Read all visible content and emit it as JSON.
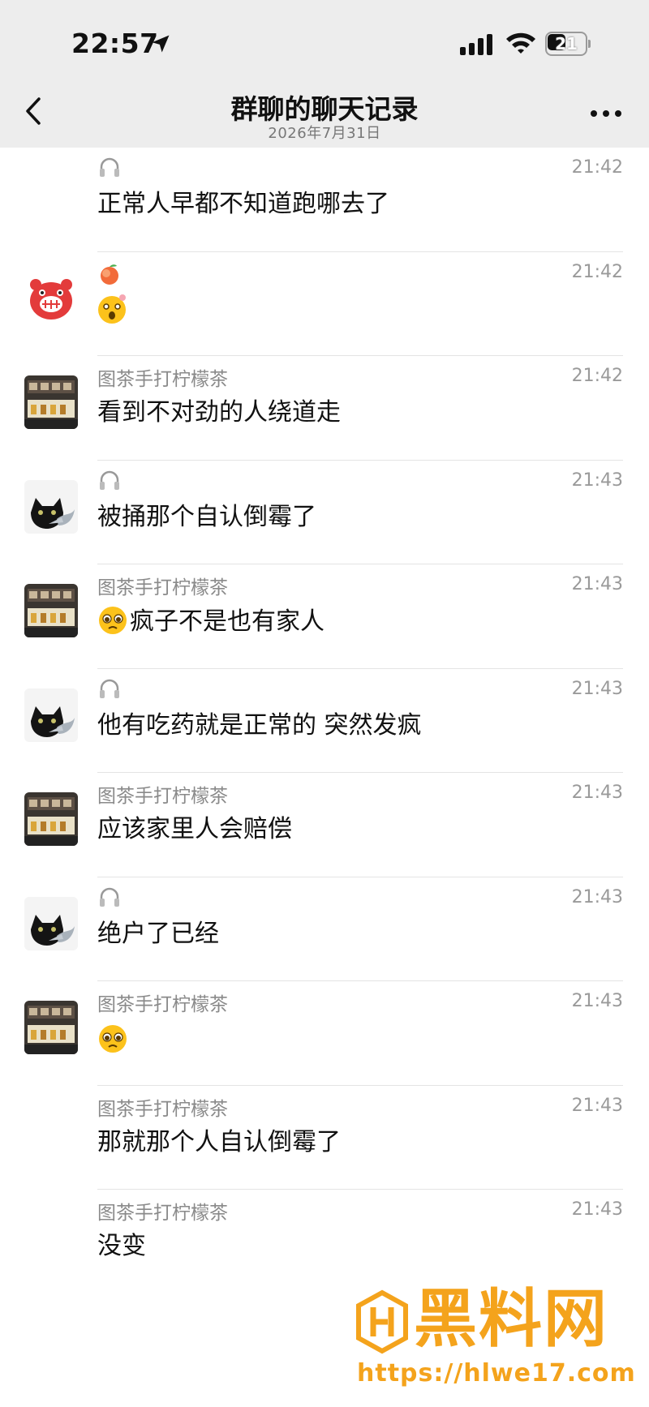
{
  "status_bar": {
    "time": "22:57",
    "battery_level": "21",
    "icons": [
      "location-arrow-icon",
      "signal-icon",
      "wifi-icon",
      "battery-icon"
    ]
  },
  "header": {
    "title": "群聊的聊天记录",
    "subtitle": "2026年7月31日",
    "back_icon": "chevron-left-icon",
    "more_icon": "ellipsis-icon",
    "background": "#ededed"
  },
  "messages": [
    {
      "avatar": "",
      "name": "",
      "name_icon": "headphones-icon",
      "time": "21:42",
      "text": "正常人早都不知道跑哪去了"
    },
    {
      "avatar": "pig-avatar",
      "name": "",
      "name_icon": "peach-emoji-icon",
      "time": "21:42",
      "text": "",
      "text_icon": "astonished-emoji-icon"
    },
    {
      "avatar": "tea-shop-avatar",
      "name": "图茶手打柠檬茶",
      "time": "21:42",
      "text": "看到不对劲的人绕道走"
    },
    {
      "avatar": "cat-avatar",
      "name": "",
      "name_icon": "headphones-icon",
      "time": "21:43",
      "text": "被捅那个自认倒霉了"
    },
    {
      "avatar": "tea-shop-avatar",
      "name": "图茶手打柠檬茶",
      "time": "21:43",
      "text": "疯子不是也有家人",
      "text_icon": "pleading-emoji-icon"
    },
    {
      "avatar": "cat-avatar",
      "name": "",
      "name_icon": "headphones-icon",
      "time": "21:43",
      "text": "他有吃药就是正常的 突然发疯"
    },
    {
      "avatar": "tea-shop-avatar",
      "name": "图茶手打柠檬茶",
      "time": "21:43",
      "text": "应该家里人会赔偿"
    },
    {
      "avatar": "cat-avatar",
      "name": "",
      "name_icon": "headphones-icon",
      "time": "21:43",
      "text": "绝户了已经"
    },
    {
      "avatar": "tea-shop-avatar",
      "name": "图茶手打柠檬茶",
      "time": "21:43",
      "text": "",
      "text_icon": "pleading-emoji-icon"
    },
    {
      "avatar": "",
      "name": "图茶手打柠檬茶",
      "time": "21:43",
      "text": "那就那个人自认倒霉了"
    },
    {
      "avatar": "",
      "name": "图茶手打柠檬茶",
      "time": "21:43",
      "text": "没变"
    }
  ],
  "watermark": {
    "text": "黑料网",
    "url": "https://hlwe17.com",
    "color": "#f4a31c"
  }
}
